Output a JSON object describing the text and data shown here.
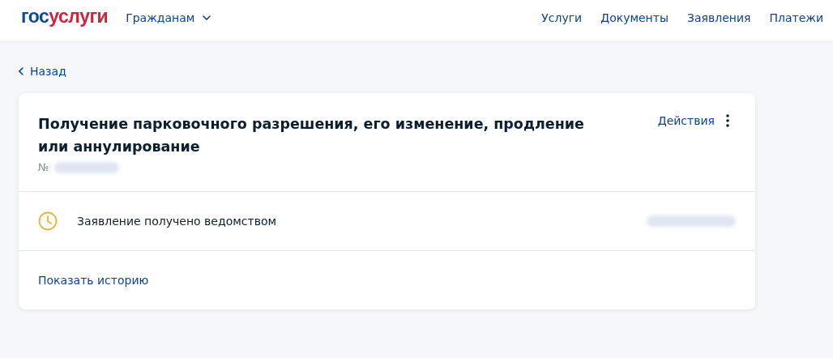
{
  "header": {
    "logo": {
      "first": "гос",
      "second": "услуги"
    },
    "audience_menu": "Гражданам",
    "nav": [
      "Услуги",
      "Документы",
      "Заявления",
      "Платежи"
    ]
  },
  "back_link": "Назад",
  "application": {
    "title": "Получение парковочного разрешения, его изменение, продление или аннулирование",
    "number_label": "№",
    "actions": "Действия",
    "status": "Заявление получено ведомством",
    "history_link": "Показать историю"
  }
}
